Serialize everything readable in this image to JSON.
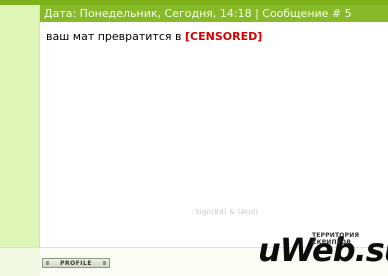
{
  "post": {
    "header": "Дата: Понедельник, Сегодня, 14:18 | Сообщение # 5",
    "message_text": "ваш мат превратится в",
    "censored_word": "[CENSORED]"
  },
  "footer": {
    "profile_label": "PROFILE"
  },
  "watermark": {
    "faint_text": "Sign(Ed) & (Aud)",
    "logo_main": "uWeb.su",
    "logo_sub_1": "ТЕРРИТОРИЯ",
    "logo_sub_2": "СКРИПТОВ"
  },
  "colors": {
    "header_bg": "#88b92a",
    "left_column_bg": "#ddf6b7",
    "censored_text": "#d40000"
  }
}
